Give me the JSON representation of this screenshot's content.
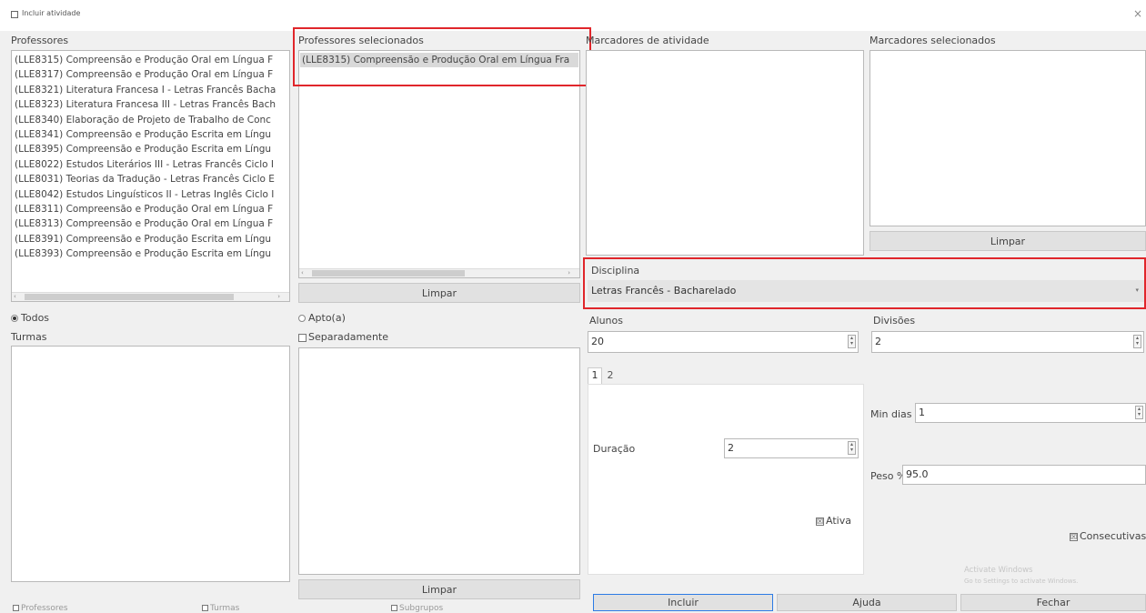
{
  "window": {
    "title": "Incluir atividade",
    "close_glyph": "×"
  },
  "teachers": {
    "label": "Professores",
    "items": [
      "(LLE8315) Compreensão e Produção Oral em Língua F",
      "(LLE8317) Compreensão e Produção Oral em Língua F",
      "(LLE8321) Literatura Francesa I - Letras Francês Bacha",
      "(LLE8323) Literatura Francesa III - Letras Francês Bach",
      "(LLE8340) Elaboração de Projeto de Trabalho de Conc",
      "(LLE8341) Compreensão e Produção Escrita em Língu",
      "(LLE8395) Compreensão e Produção Escrita em Língu",
      "(LLE8022) Estudos Literários III - Letras Francês Ciclo I",
      "(LLE8031) Teorias da Tradução - Letras Francês Ciclo E",
      "(LLE8042) Estudos Linguísticos II - Letras Inglês Ciclo I",
      "(LLE8311) Compreensão e Produção Oral em Língua F",
      "(LLE8313) Compreensão e Produção Oral em Língua F",
      "(LLE8391) Compreensão e Produção Escrita em Língu",
      "(LLE8393) Compreensão e Produção Escrita em Língu"
    ]
  },
  "selected_teachers": {
    "label": "Professores selecionados",
    "items": [
      "(LLE8315) Compreensão e Produção Oral em Língua Fra"
    ],
    "clear_label": "Limpar"
  },
  "activity_tags": {
    "label": "Marcadores de atividade"
  },
  "selected_tags": {
    "label": "Marcadores selecionados",
    "clear_label": "Limpar"
  },
  "subject": {
    "label": "Disciplina",
    "value": "Letras Francês - Bacharelado"
  },
  "filters": {
    "all_label": "Todos",
    "apt_label": "Apto(a)"
  },
  "classes": {
    "label": "Turmas",
    "separately_label": "Separadamente",
    "clear_label": "Limpar"
  },
  "students": {
    "label": "Alunos",
    "value": "20"
  },
  "divisions": {
    "label": "Divisões",
    "value": "2"
  },
  "tabs": [
    "1",
    "2"
  ],
  "duration": {
    "label": "Duração",
    "value": "2"
  },
  "active": {
    "label": "Ativa",
    "checked": true
  },
  "min_days": {
    "label": "Min dias",
    "value": "1"
  },
  "weight": {
    "label": "Peso %",
    "value": "95.0"
  },
  "consecutive": {
    "label": "Consecutivas",
    "checked": true
  },
  "watermark": {
    "line1": "Activate Windows",
    "line2": "Go to Settings to activate Windows."
  },
  "actions": {
    "include": "Incluir",
    "help": "Ajuda",
    "close": "Fechar"
  },
  "bottom_checks": [
    "Professores",
    "Turmas",
    "Subgrupos"
  ]
}
